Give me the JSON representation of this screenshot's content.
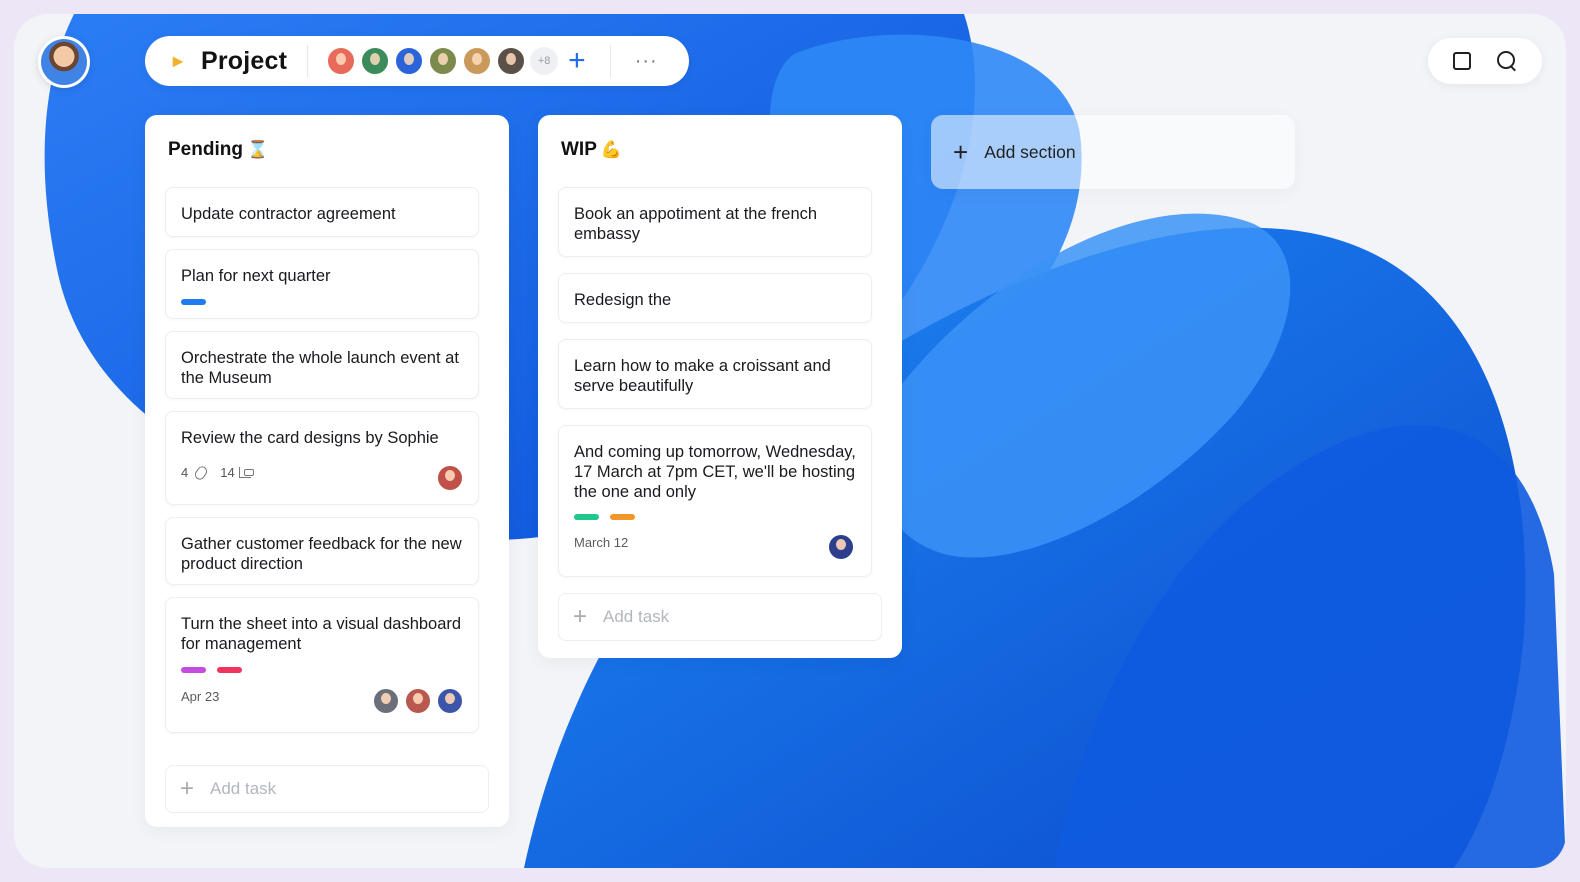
{
  "header": {
    "project_icon": "megaphone-icon",
    "title": "Project",
    "members": [
      {
        "name": "member-1",
        "color": "#e86a5a"
      },
      {
        "name": "member-2",
        "color": "#3b8c5a"
      },
      {
        "name": "member-3",
        "color": "#2b64d8"
      },
      {
        "name": "member-4",
        "color": "#7c8b4d"
      },
      {
        "name": "member-5",
        "color": "#c99a5b"
      },
      {
        "name": "member-6",
        "color": "#5a5048"
      }
    ],
    "more_members": "+8",
    "add_member": "+",
    "menu": "···"
  },
  "top_right": {
    "layout_icon": "square-icon",
    "search_icon": "search-icon"
  },
  "columns": {
    "pending": {
      "title": "Pending",
      "emoji": "⌛",
      "cards": [
        {
          "title": "Update contractor agreement"
        },
        {
          "title": "Plan for next quarter",
          "tags": [
            "#1f7cf0"
          ]
        },
        {
          "title": "Orchestrate the whole launch event at the Museum"
        },
        {
          "title": "Review the card designs by Sophie",
          "attachments": "4",
          "subtasks": "14"
        },
        {
          "title": "Gather customer feedback for the new product direction"
        },
        {
          "title": "Turn the sheet into a visual dashboard for management",
          "tags": [
            "#c64ce0",
            "#f0345f"
          ],
          "date": "Apr 23"
        }
      ],
      "add_task": "Add task"
    },
    "wip": {
      "title": "WIP",
      "emoji": "💪",
      "cards": [
        {
          "title": "Book an appotiment at the french embassy"
        },
        {
          "title": "Redesign the"
        },
        {
          "title": "Learn how to make a croissant and serve beautifully"
        },
        {
          "title": "And coming up tomorrow, Wednesday, 17 March at 7pm CET, we'll be hosting the one and only",
          "tags": [
            "#1fc98b",
            "#f0962a"
          ],
          "date": "March 12"
        }
      ],
      "add_task": "Add task"
    }
  },
  "add_section": "Add section",
  "colors": {
    "accent": "#1f6cf0",
    "background": "#f2f4f7",
    "blob": "#1b6ff2"
  }
}
